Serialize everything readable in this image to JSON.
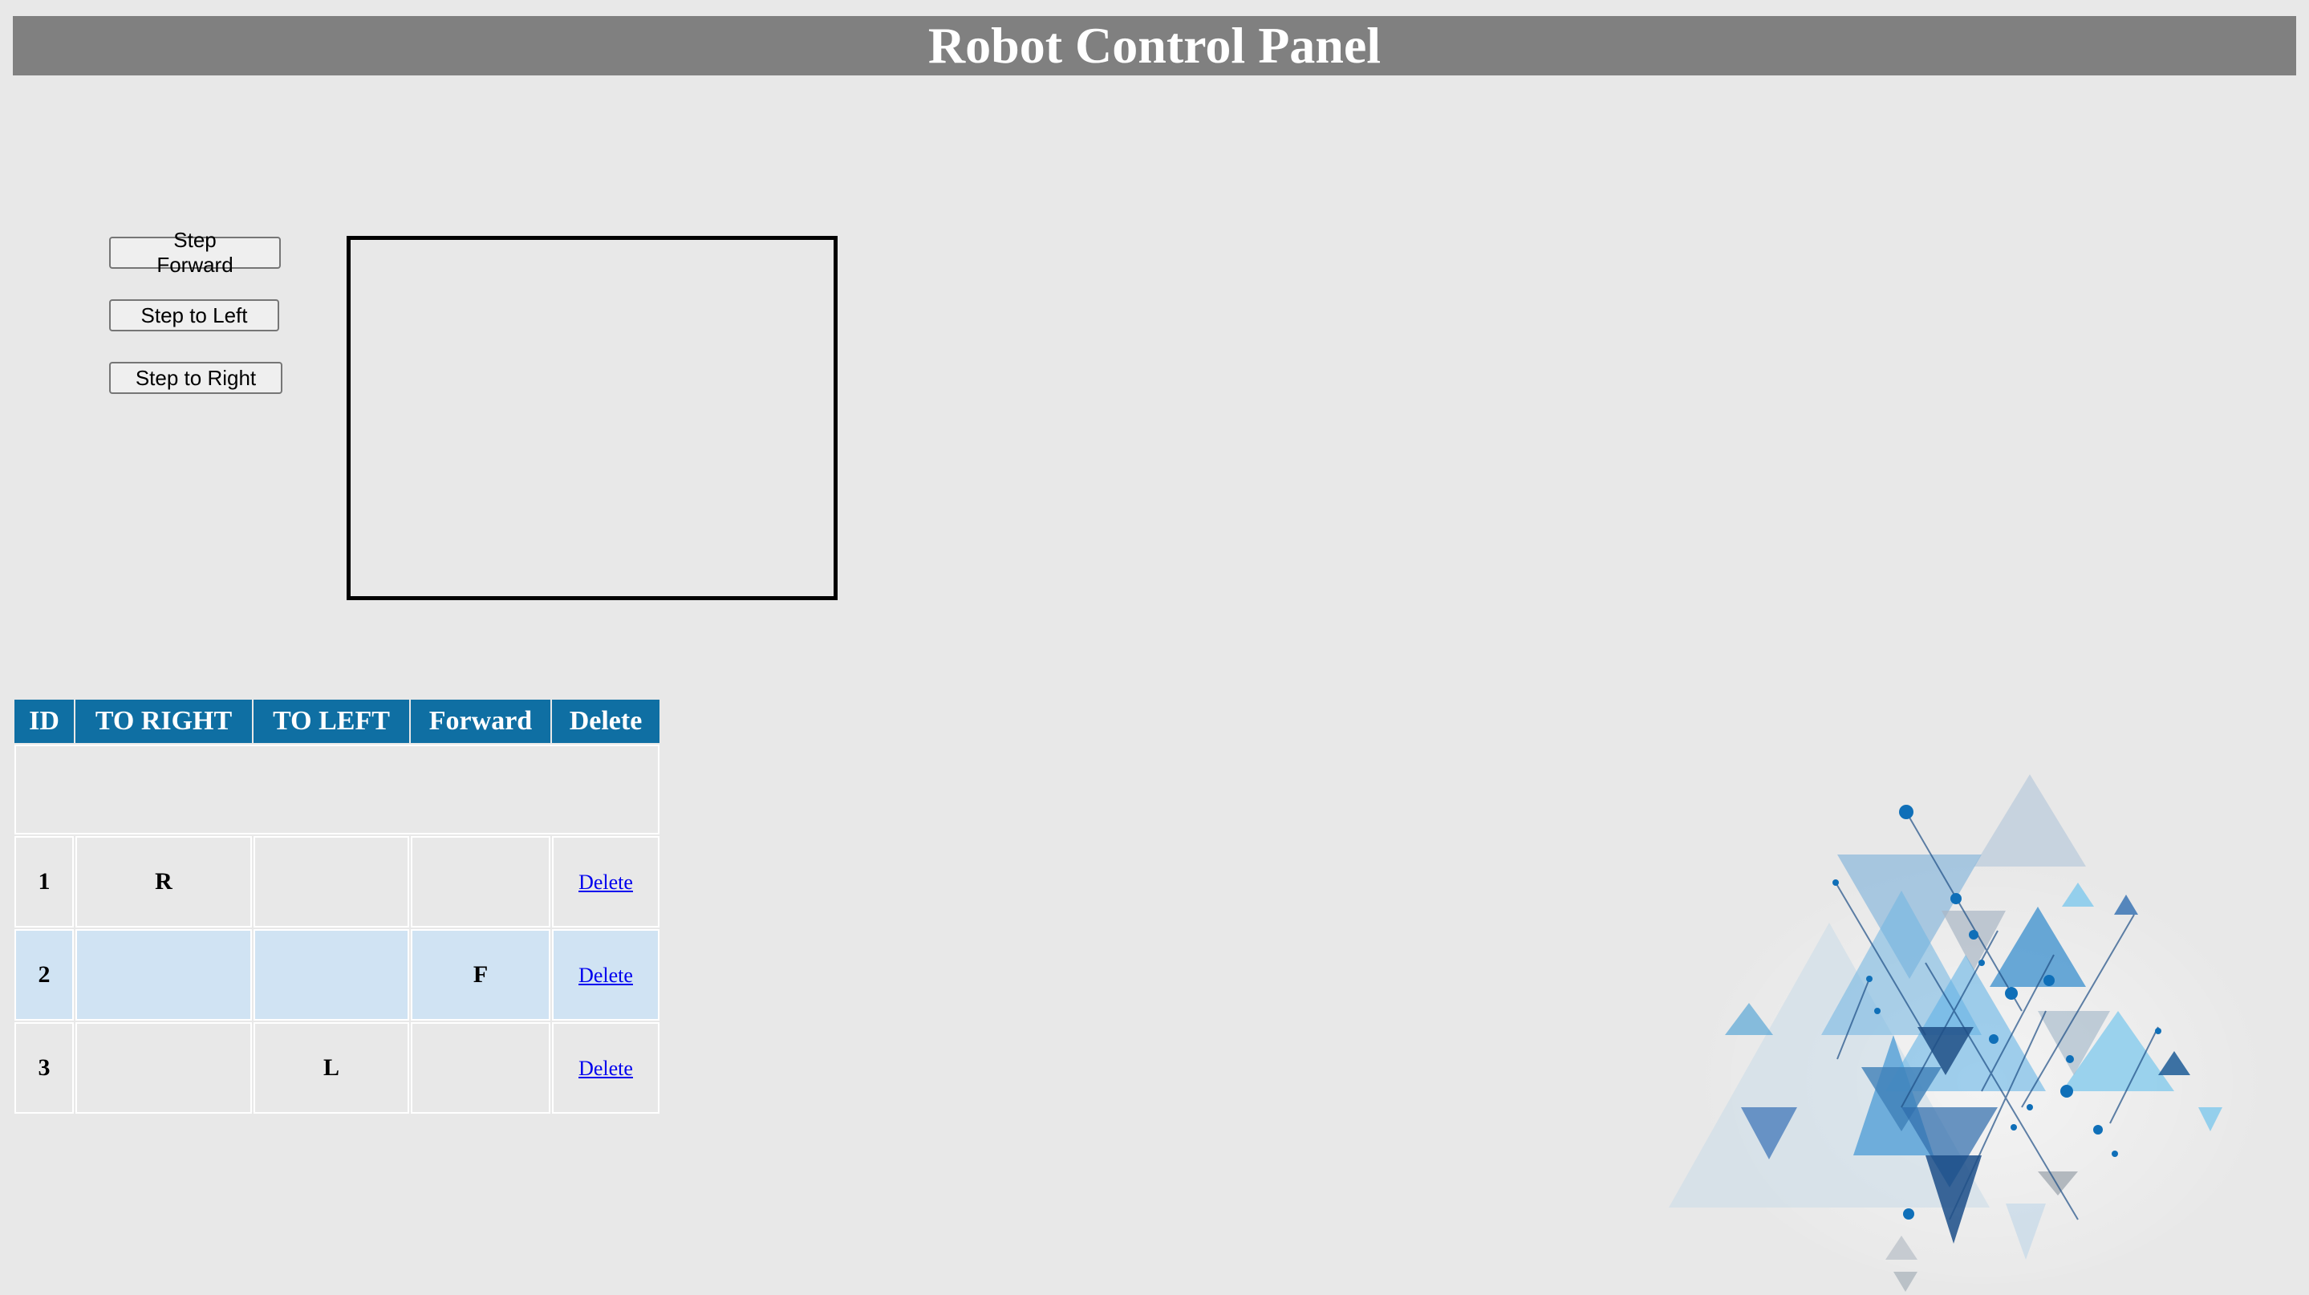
{
  "header": {
    "title": "Robot Control Panel"
  },
  "controls": {
    "forward_label": "Step Forward",
    "left_label": "Step to Left",
    "right_label": "Step to Right"
  },
  "table": {
    "headers": [
      "ID",
      "TO RIGHT",
      "TO LEFT",
      "Forward",
      "Delete"
    ],
    "rows": [
      {
        "id": "1",
        "right": "R",
        "left": "",
        "forward": "",
        "delete": "Delete"
      },
      {
        "id": "2",
        "right": "",
        "left": "",
        "forward": "F",
        "delete": "Delete"
      },
      {
        "id": "3",
        "right": "",
        "left": "L",
        "forward": "",
        "delete": "Delete"
      }
    ]
  },
  "colors": {
    "header_bg": "#808080",
    "table_header_bg": "#0f6fa3",
    "alt_row_bg": "#d0e3f3",
    "page_bg": "#e8e8e8"
  },
  "icons": {
    "decoration": "abstract-triangles-graphic"
  }
}
